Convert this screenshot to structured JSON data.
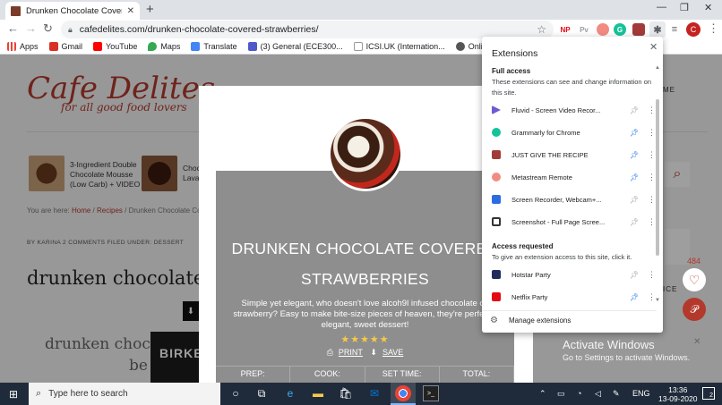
{
  "browser": {
    "tab_title": "Drunken Chocolate Covered Strawberries",
    "url": "cafedelites.com/drunken-chocolate-covered-strawberries/",
    "profile_initial": "C",
    "ext_icons": [
      "NP",
      "Pv"
    ]
  },
  "bookmarks": [
    {
      "label": "Apps",
      "color": "#ea4335"
    },
    {
      "label": "Gmail",
      "color": "#d93025"
    },
    {
      "label": "YouTube",
      "color": "#ff0000"
    },
    {
      "label": "Maps",
      "color": "#34a853"
    },
    {
      "label": "Translate",
      "color": "#4285f4"
    },
    {
      "label": "(3) General (ECE300...",
      "color": "#5059c9"
    },
    {
      "label": "ICSI.UK (Internation...",
      "color": "#7a7a7a"
    },
    {
      "label": "Online Ping, Tracer...",
      "color": "#555555"
    }
  ],
  "site": {
    "logo_name": "Cafe Delites",
    "logo_tag": "for all good food lovers",
    "cards": [
      {
        "line1": "3-Ingredient Double",
        "line2": "Chocolate Mousse",
        "line3": "(Low Carb) + VIDEO"
      },
      {
        "line1": "Choc",
        "line2": "Lava",
        "line3": ""
      }
    ],
    "crumb_prefix": "You are here:",
    "crumb_home": "Home",
    "crumb_recipes": "Recipes",
    "crumb_current": "Drunken Chocolate Co",
    "byline": "BY KARINA 2 COMMENTS FILED UNDER: DESSERT",
    "big_title": "drunken chocolate",
    "ad_line1": "drunken choc",
    "ad_line2": "be",
    "birk": "BIRKE",
    "right_me": "ME",
    "right_ice": "ICE",
    "share_count": "484"
  },
  "recipe": {
    "title_line1": "DRUNKEN CHOCOLATE COVERED",
    "title_line2": "STRAWBERRIES",
    "description": "Simple yet elegant, who doesn't love alcoh9l infused chocolate co strawberry? Easy to make bite-size pieces of heaven, they're perfectly elegant, sweet dessert!",
    "stars": "★★★★★",
    "print_label": "PRINT",
    "save_label": "SAVE",
    "times": [
      "PREP:",
      "COOK:",
      "SET TIME:",
      "TOTAL:"
    ]
  },
  "extensions_popup": {
    "title": "Extensions",
    "full_access_title": "Full access",
    "full_access_desc": "These extensions can see and change information on this site.",
    "full_access": [
      {
        "name": "Fluvid - Screen Video Recor...",
        "pinned": false,
        "color": "#6b5bd6"
      },
      {
        "name": "Grammarly for Chrome",
        "pinned": true,
        "color": "#15c39a"
      },
      {
        "name": "JUST GIVE THE RECIPE",
        "pinned": true,
        "color": "#a33a3a"
      },
      {
        "name": "Metastream Remote",
        "pinned": true,
        "color": "#e06666"
      },
      {
        "name": "Screen Recorder, Webcam+...",
        "pinned": false,
        "color": "#2d6cdf"
      },
      {
        "name": "Screenshot - Full Page Scree...",
        "pinned": false,
        "color": "#333333"
      }
    ],
    "requested_title": "Access requested",
    "requested_desc": "To give an extension access to this site, click it.",
    "requested": [
      {
        "name": "Hotstar Party",
        "pinned": false,
        "color": "#1f2d5a"
      },
      {
        "name": "Netflix Party",
        "pinned": true,
        "color": "#e50914"
      }
    ],
    "manage_label": "Manage extensions"
  },
  "watermark": {
    "line1": "Activate Windows",
    "line2": "Go to Settings to activate Windows."
  },
  "taskbar": {
    "search_placeholder": "Type here to search",
    "lang": "ENG",
    "time": "13:36",
    "date": "13-09-2020",
    "notifications": "2"
  }
}
